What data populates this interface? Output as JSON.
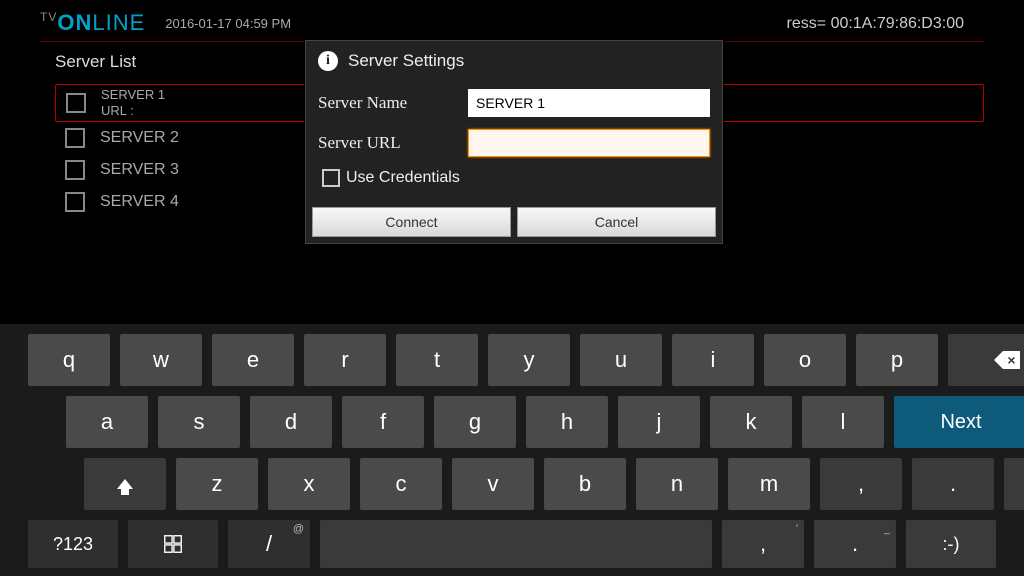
{
  "header": {
    "logo_tv": "TV",
    "logo_on": "ON",
    "logo_line": "LINE",
    "timestamp": "2016-01-17 04:59 PM",
    "mac_label": "ress=",
    "mac_value": "00:1A:79:86:D3:00"
  },
  "section_title": "Server List",
  "servers": [
    {
      "name": "SERVER 1",
      "url_label": "URL :"
    },
    {
      "name": "SERVER 2"
    },
    {
      "name": "SERVER 3"
    },
    {
      "name": "SERVER 4"
    }
  ],
  "dialog": {
    "title": "Server Settings",
    "server_name_label": "Server Name",
    "server_name_value": "SERVER 1",
    "server_url_label": "Server URL",
    "server_url_value": "",
    "use_credentials_label": "Use Credentials",
    "connect_label": "Connect",
    "cancel_label": "Cancel"
  },
  "keyboard": {
    "row1": [
      "q",
      "w",
      "e",
      "r",
      "t",
      "y",
      "u",
      "i",
      "o",
      "p"
    ],
    "row2": [
      "a",
      "s",
      "d",
      "f",
      "g",
      "h",
      "j",
      "k",
      "l"
    ],
    "row3": [
      "z",
      "x",
      "c",
      "v",
      "b",
      "n",
      "m",
      ",",
      "."
    ],
    "next_label": "Next",
    "sym_label": "?123",
    "slash": "/",
    "slash_sup": "@",
    "comma2": ",",
    "comma2_sup": "'",
    "dot2": ".",
    "dot2_sup": "_",
    "smile": ":-)"
  }
}
